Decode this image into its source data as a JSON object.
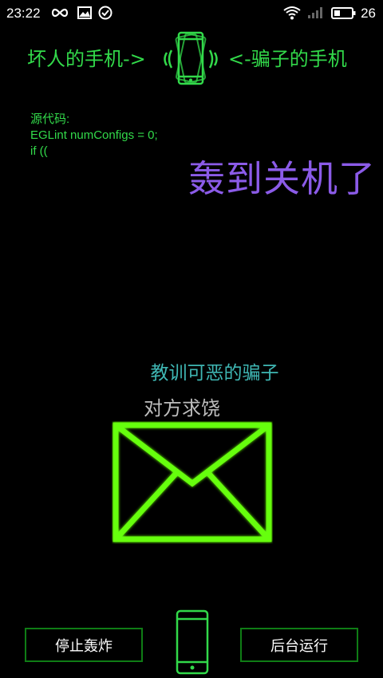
{
  "status_bar": {
    "time": "23:22",
    "battery_level": "26",
    "icons": [
      "infinity-icon",
      "image-icon",
      "check-circle-icon",
      "wifi-icon",
      "signal-icon",
      "battery-icon"
    ]
  },
  "header": {
    "left_label": "坏人的手机->",
    "right_label": "<-骗子的手机",
    "phone_icon": "vibrating-phone-icon"
  },
  "source_code": {
    "title": "源代码:",
    "lines": [
      "EGLint numConfigs = 0;",
      "if (("
    ]
  },
  "status_message": "轰到关机了",
  "punish_label": "教训可恶的骗子",
  "beg_label": "对方求饶",
  "envelope_icon": "envelope-icon",
  "buttons": {
    "stop": "停止轰炸",
    "background": "后台运行"
  },
  "bottom_phone_icon": "phone-icon",
  "colors": {
    "accent_green": "#32d94a",
    "purple": "#8b5be8",
    "teal": "#3fb7b4",
    "envelope_green": "#66ff11",
    "button_border": "#0f7d15"
  }
}
